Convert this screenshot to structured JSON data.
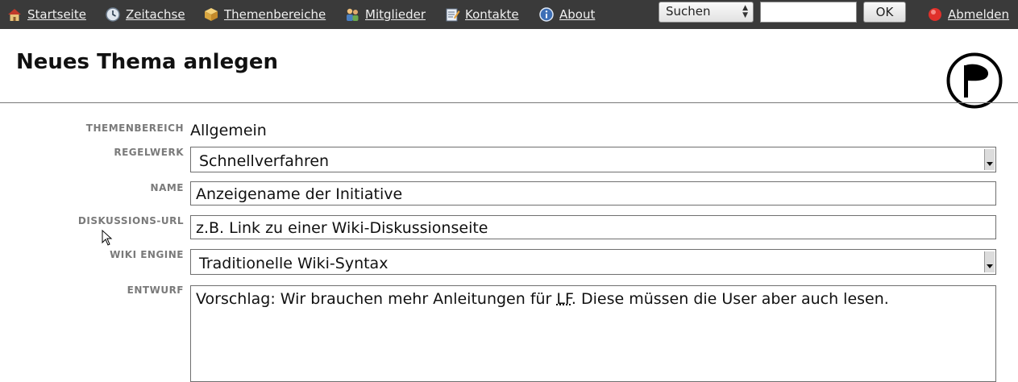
{
  "nav": {
    "items": [
      {
        "label": "Startseite",
        "icon": "home-icon"
      },
      {
        "label": "Zeitachse",
        "icon": "clock-icon"
      },
      {
        "label": "Themenbereiche",
        "icon": "box-icon"
      },
      {
        "label": "Mitglieder",
        "icon": "members-icon"
      },
      {
        "label": "Kontakte",
        "icon": "notepad-icon"
      },
      {
        "label": "About",
        "icon": "info-icon"
      }
    ],
    "search_select_value": "Suchen",
    "search_input_value": "",
    "ok_label": "OK",
    "logout_label": "Abmelden"
  },
  "page": {
    "title": "Neues Thema anlegen"
  },
  "form": {
    "themenbereich": {
      "label": "Themenbereich",
      "value": "Allgemein"
    },
    "regelwerk": {
      "label": "Regelwerk",
      "value": "Schnellverfahren"
    },
    "name": {
      "label": "Name",
      "value": "Anzeigename der Initiative"
    },
    "diskussions_url": {
      "label": "Diskussions-URL",
      "value": "z.B. Link zu einer Wiki-Diskussionseite"
    },
    "wiki_engine": {
      "label": "Wiki Engine",
      "value": "Traditionelle Wiki-Syntax"
    },
    "entwurf": {
      "label": "Entwurf",
      "value_before": "Vorschlag: Wir brauchen mehr Anleitungen für ",
      "value_abbr": "LF",
      "value_after": ". Diese müssen die User aber auch lesen."
    }
  },
  "colors": {
    "topbar": "#3a3a3a",
    "label_gray": "#7a7a7a",
    "logout_icon": "#e0302a"
  }
}
